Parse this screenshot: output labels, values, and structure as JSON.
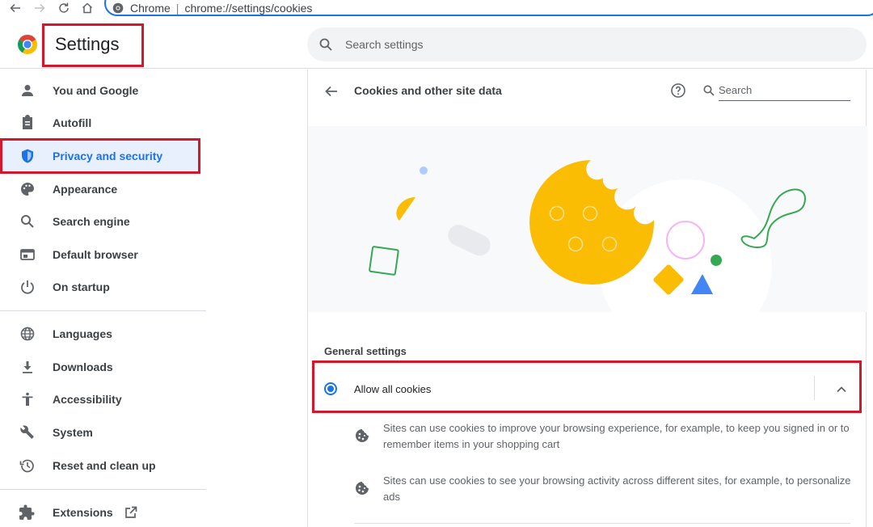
{
  "browser": {
    "chip_label": "Chrome",
    "separator": "|",
    "url": "chrome://settings/cookies"
  },
  "header": {
    "title": "Settings",
    "search_placeholder": "Search settings"
  },
  "sidebar": {
    "items": [
      {
        "label": "You and Google",
        "icon": "person-icon"
      },
      {
        "label": "Autofill",
        "icon": "clipboard-icon"
      },
      {
        "label": "Privacy and security",
        "icon": "shield-icon",
        "active": true
      },
      {
        "label": "Appearance",
        "icon": "palette-icon"
      },
      {
        "label": "Search engine",
        "icon": "search-icon"
      },
      {
        "label": "Default browser",
        "icon": "browser-window-icon"
      },
      {
        "label": "On startup",
        "icon": "power-icon"
      },
      {
        "label": "Languages",
        "icon": "globe-icon"
      },
      {
        "label": "Downloads",
        "icon": "download-icon"
      },
      {
        "label": "Accessibility",
        "icon": "accessibility-icon"
      },
      {
        "label": "System",
        "icon": "wrench-icon"
      },
      {
        "label": "Reset and clean up",
        "icon": "restore-icon"
      },
      {
        "label": "Extensions",
        "icon": "puzzle-icon"
      }
    ]
  },
  "main": {
    "title": "Cookies and other site data",
    "search_label": "Search",
    "section_label": "General settings",
    "allow_all_label": "Allow all cookies",
    "descriptions": [
      "Sites can use cookies to improve your browsing experience, for example, to keep you signed in or to remember items in your shopping cart",
      "Sites can use cookies to see your browsing activity across different sites, for example, to personalize ads"
    ]
  },
  "colors": {
    "accent": "#1a73e8",
    "highlight_border": "#d3182b",
    "cookie_yellow": "#fbbc04"
  }
}
